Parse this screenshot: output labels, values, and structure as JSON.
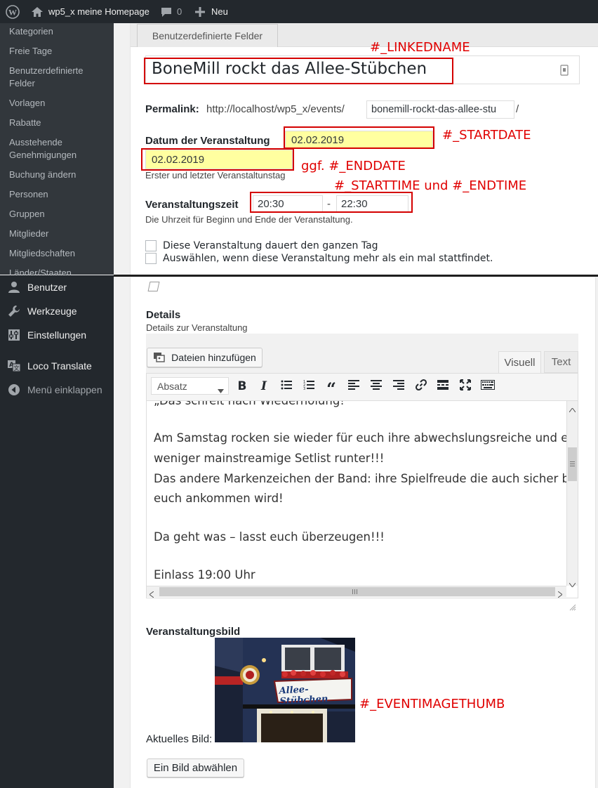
{
  "adminbar": {
    "site_name": "wp5_x meine Homepage",
    "comments_count": "0",
    "new_label": "Neu"
  },
  "sidebar": {
    "submenu": [
      "Kategorien",
      "Freie Tage",
      "Benutzerdefinierte Felder",
      "Vorlagen",
      "Rabatte",
      "Ausstehende Genehmigungen",
      "Buchung ändern",
      "Personen",
      "Gruppen",
      "Mitglieder",
      "Mitgliedschaften",
      "Länder/Staaten"
    ],
    "menu": [
      {
        "label": "Benutzer",
        "icon": "user-icon"
      },
      {
        "label": "Werkzeuge",
        "icon": "wrench-icon"
      },
      {
        "label": "Einstellungen",
        "icon": "settings-sliders-icon"
      },
      {
        "label": "Loco Translate",
        "icon": "translate-icon"
      }
    ],
    "collapse_label": "Menü einklappen"
  },
  "tabs": {
    "custom_fields": "Benutzerdefinierte Felder"
  },
  "event": {
    "title": "BoneMill rockt das Allee-Stübchen",
    "permalink_label": "Permalink:",
    "permalink_base": "http://localhost/wp5_x/events/",
    "permalink_slug": "bonemill-rockt-das-allee-stu",
    "permalink_trail": "/",
    "date_label": "Datum der Veranstaltung",
    "start_date": "02.02.2019",
    "end_date": "02.02.2019",
    "date_hint": "Erster und letzter Veranstaltunstag",
    "time_label": "Veranstaltungszeit",
    "start_time": "20:30",
    "time_separator": "-",
    "end_time": "22:30",
    "time_hint": "Die Uhrzeit für Beginn und Ende der Veranstaltung.",
    "allday_label": "Diese Veranstaltung dauert den ganzen Tag",
    "recurring_label": "Auswählen, wenn diese Veranstaltung mehr als ein mal stattfindet."
  },
  "annotations": {
    "linkedname": "#_LINKEDNAME",
    "startdate": "#_STARTDATE",
    "enddate": "ggf. #_ENDDATE",
    "times": "#_STARTTIME  und  #_ENDTIME",
    "imagethumb": "#_EVENTIMAGETHUMB"
  },
  "details": {
    "heading": "Details",
    "subheading": "Details zur Veranstaltung",
    "add_media": "Dateien hinzufügen",
    "tab_visual": "Visuell",
    "tab_text": "Text",
    "format_select": "Absatz",
    "content": [
      "„Das schreit nach Wiederholung!",
      "Am Samstag rocken sie wieder für euch ihre abwechslungsreiche und eher",
      "weniger mainstreamige Setlist runter!!!",
      "Das andere Markenzeichen der Band: ihre Spielfreude die auch sicher bei",
      "euch ankommen wird!",
      "Da geht was – lasst euch überzeugen!!!",
      "Einlass 19:00 Uhr"
    ]
  },
  "image": {
    "heading": "Veranstaltungsbild",
    "current_label": "Aktuelles Bild:",
    "sign_text": "Allee-Stübchen",
    "remove_button": "Ein Bild abwählen"
  },
  "colors": {
    "annotation": "#e00000",
    "sidebar_bg": "#23282d",
    "field_highlight": "#ffffa0"
  }
}
